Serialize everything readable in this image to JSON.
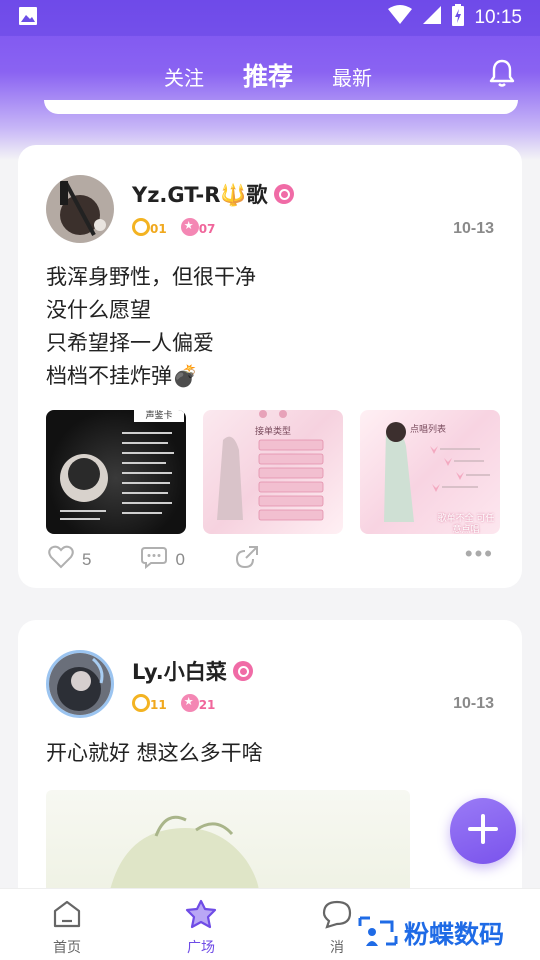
{
  "status_bar": {
    "time": "10:15"
  },
  "top_tabs": [
    {
      "label": "关注"
    },
    {
      "label": "推荐"
    },
    {
      "label": "最新"
    }
  ],
  "posts": [
    {
      "username": "Yz.GT-R🔱歌",
      "level_a": "01",
      "level_b": "07",
      "date": "10-13",
      "lines": [
        "我浑身野性，但很干净",
        "没什么愿望",
        "只希望择一人偏爱",
        "档档不挂炸弹💣"
      ],
      "likes": "5",
      "comments": "0"
    },
    {
      "username": "Ly.小白菜",
      "level_a": "11",
      "level_b": "21",
      "date": "10-13",
      "lines": [
        "开心就好 想这么多干啥"
      ]
    }
  ],
  "thumb_text": {
    "t1_header": "声鉴卡",
    "t2_header": "接单类型",
    "t3_header": "点唱列表",
    "t3_caption": "歌单不全 可任意点唱"
  },
  "bottom_nav": [
    {
      "label": "首页"
    },
    {
      "label": "广场"
    },
    {
      "label": "消"
    }
  ],
  "watermark": {
    "text": "粉蝶数码"
  },
  "colors": {
    "accent": "#7b52f0",
    "active_nav": "#6f4ce6",
    "gold": "#f3b322",
    "pink": "#f487b4"
  }
}
